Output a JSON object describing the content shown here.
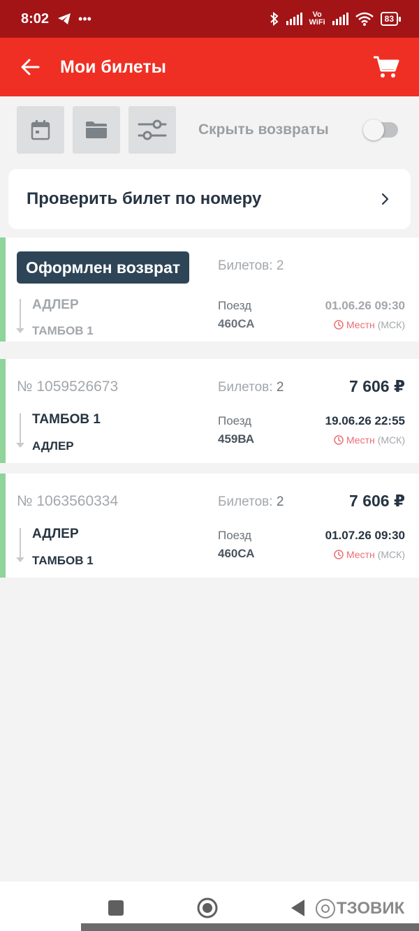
{
  "status_bar": {
    "time": "8:02",
    "volte_top": "Vo",
    "volte_bottom": "WiFi",
    "battery": "83"
  },
  "app_bar": {
    "title": "Мои билеты"
  },
  "toolbar": {
    "toggle_label": "Скрыть возвраты",
    "toggle_on": false
  },
  "check_ticket": {
    "label": "Проверить билет по номеру"
  },
  "tickets": [
    {
      "status_chip": "Оформлен возврат",
      "tickets_label": "Билетов:",
      "tickets_count": "2",
      "from": "АДЛЕР",
      "to": "ТАМБОВ 1",
      "train_label": "Поезд",
      "train_no": "460СА",
      "datetime": "01.06.26 09:30",
      "tz_local": "Местн",
      "tz_msk": "(МСК)"
    },
    {
      "number": "№ 1059526673",
      "tickets_label": "Билетов:",
      "tickets_count": "2",
      "price": "7 606 ₽",
      "from": "ТАМБОВ 1",
      "to": "АДЛЕР",
      "train_label": "Поезд",
      "train_no": "459ВА",
      "datetime": "19.06.26 22:55",
      "tz_local": "Местн",
      "tz_msk": "(МСК)"
    },
    {
      "number": "№ 1063560334",
      "tickets_label": "Билетов:",
      "tickets_count": "2",
      "price": "7 606 ₽",
      "from": "АДЛЕР",
      "to": "ТАМБОВ 1",
      "train_label": "Поезд",
      "train_no": "460СА",
      "datetime": "01.07.26 09:30",
      "tz_local": "Местн",
      "tz_msk": "(МСК)"
    }
  ],
  "watermark": {
    "text": "ТЗОВИК"
  },
  "colors": {
    "status_bar": "#a31417",
    "app_bar": "#ef2f23",
    "accent_green": "#8ed49b",
    "chip": "#2e4558"
  }
}
